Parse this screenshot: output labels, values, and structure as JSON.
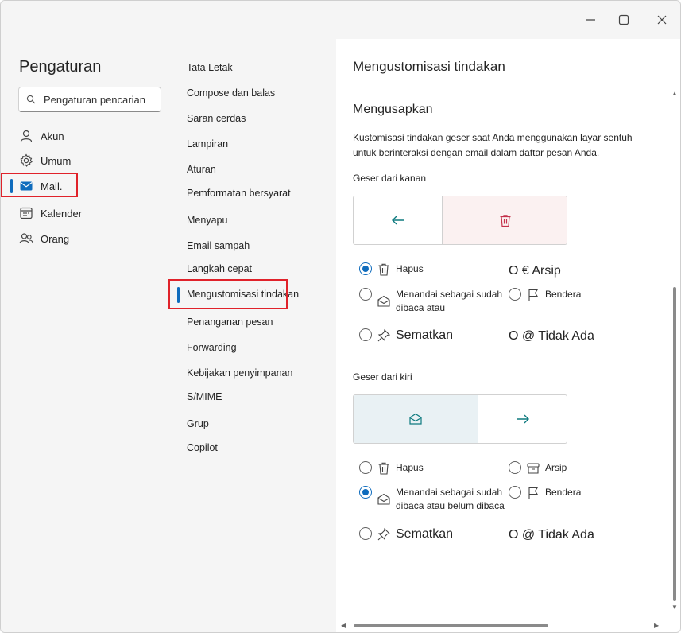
{
  "window": {
    "controls": [
      "minimize",
      "maximize",
      "close"
    ]
  },
  "leftnav": {
    "title": "Pengaturan",
    "search_placeholder": "Pengaturan pencarian",
    "items": [
      {
        "label": "Akun",
        "icon": "person-icon"
      },
      {
        "label": "Umum",
        "icon": "gear-icon"
      },
      {
        "label": "Mail.",
        "icon": "mail-icon",
        "active": true
      },
      {
        "label": "Kalender",
        "icon": "calendar-icon"
      },
      {
        "label": "Orang",
        "icon": "people-icon"
      }
    ]
  },
  "midnav": {
    "items": [
      "Tata Letak",
      "Compose dan balas",
      "Saran cerdas",
      "Lampiran",
      "Aturan",
      "Pemformatan bersyarat",
      "Menyapu",
      "Email sampah",
      "Langkah cepat",
      "Mengustomisasi tindakan",
      "Penanganan pesan",
      "Forwarding",
      "Kebijakan penyimpanan",
      "S/MIME",
      "Grup",
      "Copilot"
    ],
    "active_index": 9
  },
  "panel": {
    "title": "Mengustomisasi tindakan",
    "section": "Mengusapkan",
    "description": "Kustomisasi tindakan geser saat Anda menggunakan layar sentuh untuk berinteraksi dengan email dalam daftar pesan Anda.",
    "right_swipe": {
      "label": "Geser dari kanan",
      "options": {
        "delete": "Hapus",
        "archive_text": "O € Arsip",
        "mark_read": "Menandai sebagai sudah dibaca atau",
        "flag": "Bendera",
        "pin": "Sematkan",
        "none_text": "O @ Tidak Ada"
      },
      "selected": "delete"
    },
    "left_swipe": {
      "label": "Geser dari kiri",
      "options": {
        "delete": "Hapus",
        "archive": "Arsip",
        "mark_read": "Menandai sebagai sudah dibaca atau belum dibaca",
        "flag": "Bendera",
        "pin": "Sematkan",
        "none_text": "O @ Tidak Ada"
      },
      "selected": "mark_read"
    }
  },
  "colors": {
    "accent": "#0f6cbd",
    "highlight": "#e0222a",
    "delete_bg": "#fbf1f1",
    "read_bg": "#e9f1f4",
    "teal_icon": "#0e7a7f",
    "red_icon": "#c4314b"
  }
}
